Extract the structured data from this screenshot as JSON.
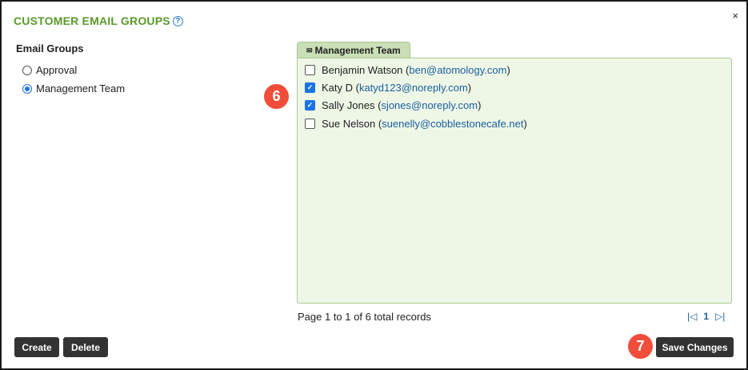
{
  "dialog": {
    "title": "CUSTOMER EMAIL GROUPS",
    "help_icon": "?",
    "close_icon": "×"
  },
  "groups": {
    "label": "Email Groups",
    "items": [
      {
        "label": "Approval",
        "selected": false
      },
      {
        "label": "Management Team",
        "selected": true
      }
    ]
  },
  "panel": {
    "tab_label": "Management Team",
    "tab_icon": "✉",
    "members": [
      {
        "name": "Benjamin Watson",
        "email": "ben@atomology.com",
        "checked": false
      },
      {
        "name": "Katy D",
        "email": "katyd123@noreply.com",
        "checked": true
      },
      {
        "name": "Sally Jones",
        "email": "sjones@noreply.com",
        "checked": true
      },
      {
        "name": "Sue Nelson",
        "email": "suenelly@cobblestonecafe.net",
        "checked": false
      }
    ]
  },
  "pager": {
    "text": "Page 1 to 1 of 6 total records",
    "page": "1",
    "first_icon": "|◁",
    "next_icon": "▷|"
  },
  "buttons": {
    "create": "Create",
    "delete": "Delete",
    "save": "Save Changes"
  },
  "callouts": {
    "six": "6",
    "seven": "7"
  },
  "colors": {
    "title_green": "#5a9a2a",
    "panel_bg": "#eef7e6",
    "tab_bg": "#c9dfb6",
    "badge_red": "#f04e3b",
    "link_blue": "#1a5fa0",
    "button_dark": "#333333"
  }
}
